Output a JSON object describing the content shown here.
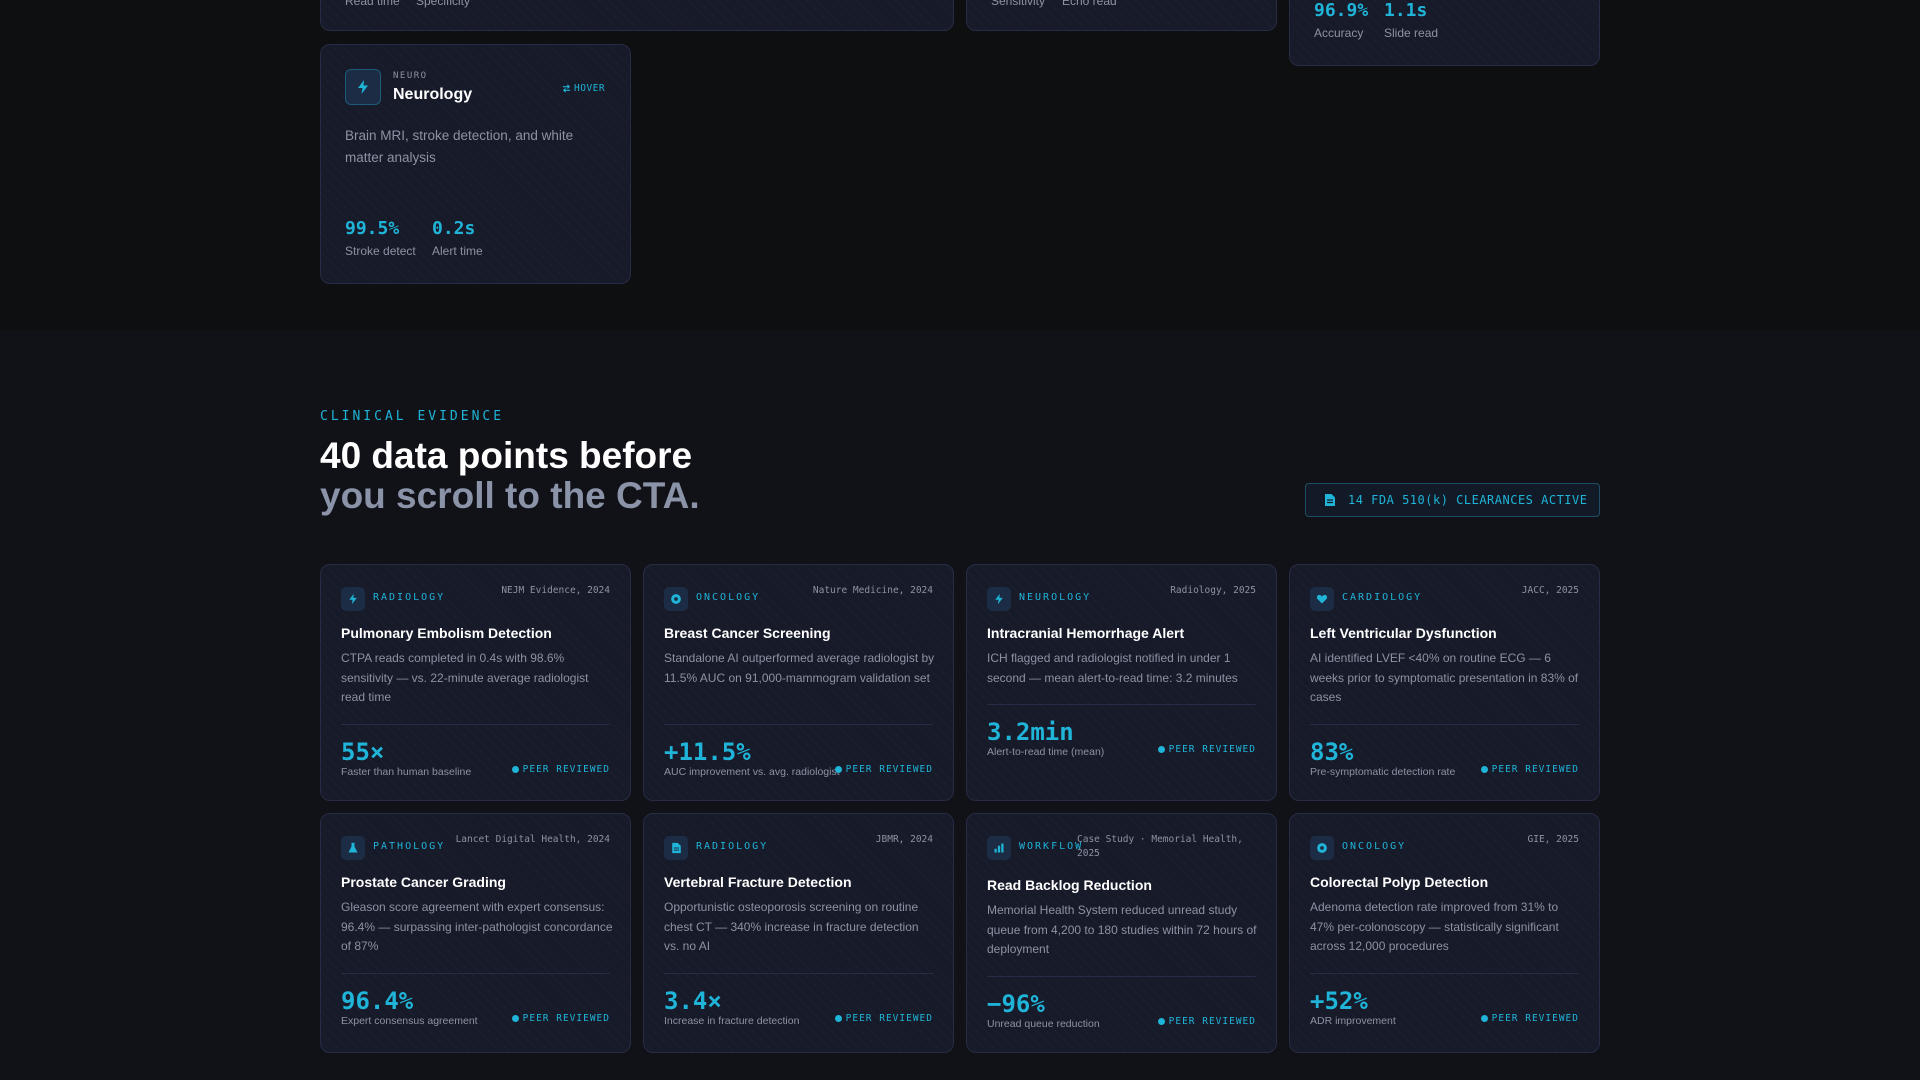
{
  "top_cards": {
    "card1": {
      "stat_labels": [
        "Read time",
        "Specificity"
      ]
    },
    "card2": {
      "stat_labels": [
        "Sensitivity",
        "Echo read"
      ]
    },
    "card3": {
      "stats": [
        {
          "value": "96.9%",
          "label": "Accuracy"
        },
        {
          "value": "1.1s",
          "label": "Slide read"
        }
      ]
    }
  },
  "neuro_card": {
    "eyebrow": "NEURO",
    "title": "Neurology",
    "hover_label": "HOVER",
    "description": "Brain MRI, stroke detection, and white matter analysis",
    "stats": [
      {
        "value": "99.5%",
        "label": "Stroke detect"
      },
      {
        "value": "0.2s",
        "label": "Alert time"
      }
    ]
  },
  "section": {
    "eyebrow": "CLINICAL EVIDENCE",
    "heading_line1": "40 data points before",
    "heading_line2": "you scroll to the CTA.",
    "fda_badge": "14 FDA 510(k) CLEARANCES ACTIVE"
  },
  "evidence_cards": [
    {
      "category": "RADIOLOGY",
      "icon": "bolt-icon",
      "source": "NEJM Evidence, 2024",
      "title": "Pulmonary Embolism Detection",
      "description": "CTPA reads completed in 0.4s with 98.6% sensitivity — vs. 22-minute average radiologist read time",
      "value": "55×",
      "value_label": "Faster than human baseline",
      "badge": "PEER REVIEWED"
    },
    {
      "category": "ONCOLOGY",
      "icon": "target-icon",
      "source": "Nature Medicine, 2024",
      "title": "Breast Cancer Screening",
      "description": "Standalone AI outperformed average radiologist by 11.5% AUC on 91,000-mammogram validation set",
      "value": "+11.5%",
      "value_label": "AUC improvement vs. avg. radiologist",
      "badge": "PEER REVIEWED"
    },
    {
      "category": "NEUROLOGY",
      "icon": "bolt-icon",
      "source": "Radiology, 2025",
      "title": "Intracranial Hemorrhage Alert",
      "description": "ICH flagged and radiologist notified in under 1 second — mean alert-to-read time: 3.2 minutes",
      "value": "3.2min",
      "value_label": "Alert-to-read time (mean)",
      "badge": "PEER REVIEWED"
    },
    {
      "category": "CARDIOLOGY",
      "icon": "heart-icon",
      "source": "JACC, 2025",
      "title": "Left Ventricular Dysfunction",
      "description": "AI identified LVEF <40% on routine ECG — 6 weeks prior to symptomatic presentation in 83% of cases",
      "value": "83%",
      "value_label": "Pre-symptomatic detection rate",
      "badge": "PEER REVIEWED"
    },
    {
      "category": "PATHOLOGY",
      "icon": "flask-icon",
      "source": "Lancet Digital Health, 2024",
      "title": "Prostate Cancer Grading",
      "description": "Gleason score agreement with expert consensus: 96.4% — surpassing inter-pathologist concordance of 87%",
      "value": "96.4%",
      "value_label": "Expert consensus agreement",
      "badge": "PEER REVIEWED"
    },
    {
      "category": "RADIOLOGY",
      "icon": "document-icon",
      "source": "JBMR, 2024",
      "title": "Vertebral Fracture Detection",
      "description": "Opportunistic osteoporosis screening on routine chest CT — 340% increase in fracture detection vs. no AI",
      "value": "3.4×",
      "value_label": "Increase in fracture detection",
      "badge": "PEER REVIEWED"
    },
    {
      "category": "WORKFLOW",
      "icon": "bar-chart-icon",
      "source": "Case Study · Memorial Health, 2025",
      "title": "Read Backlog Reduction",
      "description": "Memorial Health System reduced unread study queue from 4,200 to 180 studies within 72 hours of deployment",
      "value": "−96%",
      "value_label": "Unread queue reduction",
      "badge": "PEER REVIEWED"
    },
    {
      "category": "ONCOLOGY",
      "icon": "target-icon",
      "source": "GIE, 2025",
      "title": "Colorectal Polyp Detection",
      "description": "Adenoma detection rate improved from 31% to 47% per-colonoscopy — statistically significant across 12,000 procedures",
      "value": "+52%",
      "value_label": "ADR improvement",
      "badge": "PEER REVIEWED"
    }
  ],
  "colors": {
    "accent": "#1fb4d8",
    "card_bg": "#171a29",
    "border": "#272c44",
    "muted": "#8c93a3"
  }
}
